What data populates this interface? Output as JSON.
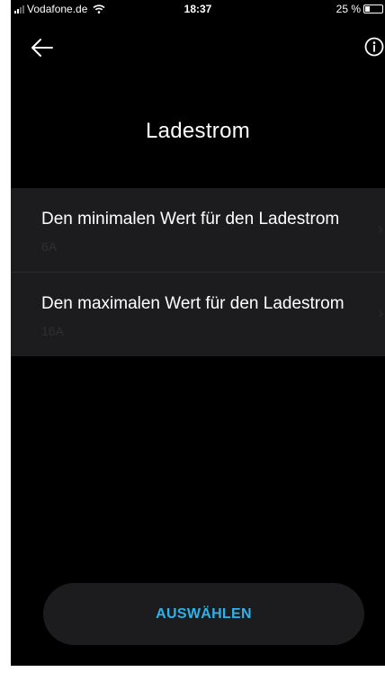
{
  "status_bar": {
    "carrier": "Vodafone.de",
    "time": "18:37",
    "battery": "25 %"
  },
  "nav": {
    "back_icon": "arrow-left-icon",
    "info_icon": "info-circle-icon"
  },
  "page": {
    "title": "Ladestrom"
  },
  "settings": {
    "items": [
      {
        "title": "Den minimalen Wert für den Ladestrom",
        "value": "6A"
      },
      {
        "title": "Den maximalen Wert für den Ladestrom",
        "value": "16A"
      }
    ]
  },
  "actions": {
    "select_label": "AUSWÄHLEN"
  },
  "colors": {
    "background": "#000000",
    "card": "#1c1c1e",
    "accent": "#2fb2e8",
    "text": "#ffffff"
  }
}
